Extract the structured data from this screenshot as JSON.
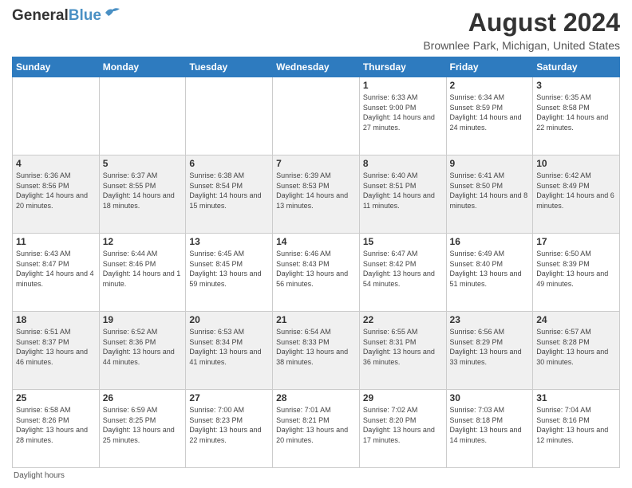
{
  "header": {
    "logo_line1": "General",
    "logo_line2": "Blue",
    "month_year": "August 2024",
    "location": "Brownlee Park, Michigan, United States"
  },
  "days_of_week": [
    "Sunday",
    "Monday",
    "Tuesday",
    "Wednesday",
    "Thursday",
    "Friday",
    "Saturday"
  ],
  "weeks": [
    [
      {
        "day": "",
        "data": ""
      },
      {
        "day": "",
        "data": ""
      },
      {
        "day": "",
        "data": ""
      },
      {
        "day": "",
        "data": ""
      },
      {
        "day": "1",
        "data": "Sunrise: 6:33 AM\nSunset: 9:00 PM\nDaylight: 14 hours and 27 minutes."
      },
      {
        "day": "2",
        "data": "Sunrise: 6:34 AM\nSunset: 8:59 PM\nDaylight: 14 hours and 24 minutes."
      },
      {
        "day": "3",
        "data": "Sunrise: 6:35 AM\nSunset: 8:58 PM\nDaylight: 14 hours and 22 minutes."
      }
    ],
    [
      {
        "day": "4",
        "data": "Sunrise: 6:36 AM\nSunset: 8:56 PM\nDaylight: 14 hours and 20 minutes."
      },
      {
        "day": "5",
        "data": "Sunrise: 6:37 AM\nSunset: 8:55 PM\nDaylight: 14 hours and 18 minutes."
      },
      {
        "day": "6",
        "data": "Sunrise: 6:38 AM\nSunset: 8:54 PM\nDaylight: 14 hours and 15 minutes."
      },
      {
        "day": "7",
        "data": "Sunrise: 6:39 AM\nSunset: 8:53 PM\nDaylight: 14 hours and 13 minutes."
      },
      {
        "day": "8",
        "data": "Sunrise: 6:40 AM\nSunset: 8:51 PM\nDaylight: 14 hours and 11 minutes."
      },
      {
        "day": "9",
        "data": "Sunrise: 6:41 AM\nSunset: 8:50 PM\nDaylight: 14 hours and 8 minutes."
      },
      {
        "day": "10",
        "data": "Sunrise: 6:42 AM\nSunset: 8:49 PM\nDaylight: 14 hours and 6 minutes."
      }
    ],
    [
      {
        "day": "11",
        "data": "Sunrise: 6:43 AM\nSunset: 8:47 PM\nDaylight: 14 hours and 4 minutes."
      },
      {
        "day": "12",
        "data": "Sunrise: 6:44 AM\nSunset: 8:46 PM\nDaylight: 14 hours and 1 minute."
      },
      {
        "day": "13",
        "data": "Sunrise: 6:45 AM\nSunset: 8:45 PM\nDaylight: 13 hours and 59 minutes."
      },
      {
        "day": "14",
        "data": "Sunrise: 6:46 AM\nSunset: 8:43 PM\nDaylight: 13 hours and 56 minutes."
      },
      {
        "day": "15",
        "data": "Sunrise: 6:47 AM\nSunset: 8:42 PM\nDaylight: 13 hours and 54 minutes."
      },
      {
        "day": "16",
        "data": "Sunrise: 6:49 AM\nSunset: 8:40 PM\nDaylight: 13 hours and 51 minutes."
      },
      {
        "day": "17",
        "data": "Sunrise: 6:50 AM\nSunset: 8:39 PM\nDaylight: 13 hours and 49 minutes."
      }
    ],
    [
      {
        "day": "18",
        "data": "Sunrise: 6:51 AM\nSunset: 8:37 PM\nDaylight: 13 hours and 46 minutes."
      },
      {
        "day": "19",
        "data": "Sunrise: 6:52 AM\nSunset: 8:36 PM\nDaylight: 13 hours and 44 minutes."
      },
      {
        "day": "20",
        "data": "Sunrise: 6:53 AM\nSunset: 8:34 PM\nDaylight: 13 hours and 41 minutes."
      },
      {
        "day": "21",
        "data": "Sunrise: 6:54 AM\nSunset: 8:33 PM\nDaylight: 13 hours and 38 minutes."
      },
      {
        "day": "22",
        "data": "Sunrise: 6:55 AM\nSunset: 8:31 PM\nDaylight: 13 hours and 36 minutes."
      },
      {
        "day": "23",
        "data": "Sunrise: 6:56 AM\nSunset: 8:29 PM\nDaylight: 13 hours and 33 minutes."
      },
      {
        "day": "24",
        "data": "Sunrise: 6:57 AM\nSunset: 8:28 PM\nDaylight: 13 hours and 30 minutes."
      }
    ],
    [
      {
        "day": "25",
        "data": "Sunrise: 6:58 AM\nSunset: 8:26 PM\nDaylight: 13 hours and 28 minutes."
      },
      {
        "day": "26",
        "data": "Sunrise: 6:59 AM\nSunset: 8:25 PM\nDaylight: 13 hours and 25 minutes."
      },
      {
        "day": "27",
        "data": "Sunrise: 7:00 AM\nSunset: 8:23 PM\nDaylight: 13 hours and 22 minutes."
      },
      {
        "day": "28",
        "data": "Sunrise: 7:01 AM\nSunset: 8:21 PM\nDaylight: 13 hours and 20 minutes."
      },
      {
        "day": "29",
        "data": "Sunrise: 7:02 AM\nSunset: 8:20 PM\nDaylight: 13 hours and 17 minutes."
      },
      {
        "day": "30",
        "data": "Sunrise: 7:03 AM\nSunset: 8:18 PM\nDaylight: 13 hours and 14 minutes."
      },
      {
        "day": "31",
        "data": "Sunrise: 7:04 AM\nSunset: 8:16 PM\nDaylight: 13 hours and 12 minutes."
      }
    ]
  ],
  "footer": {
    "daylight_label": "Daylight hours"
  }
}
